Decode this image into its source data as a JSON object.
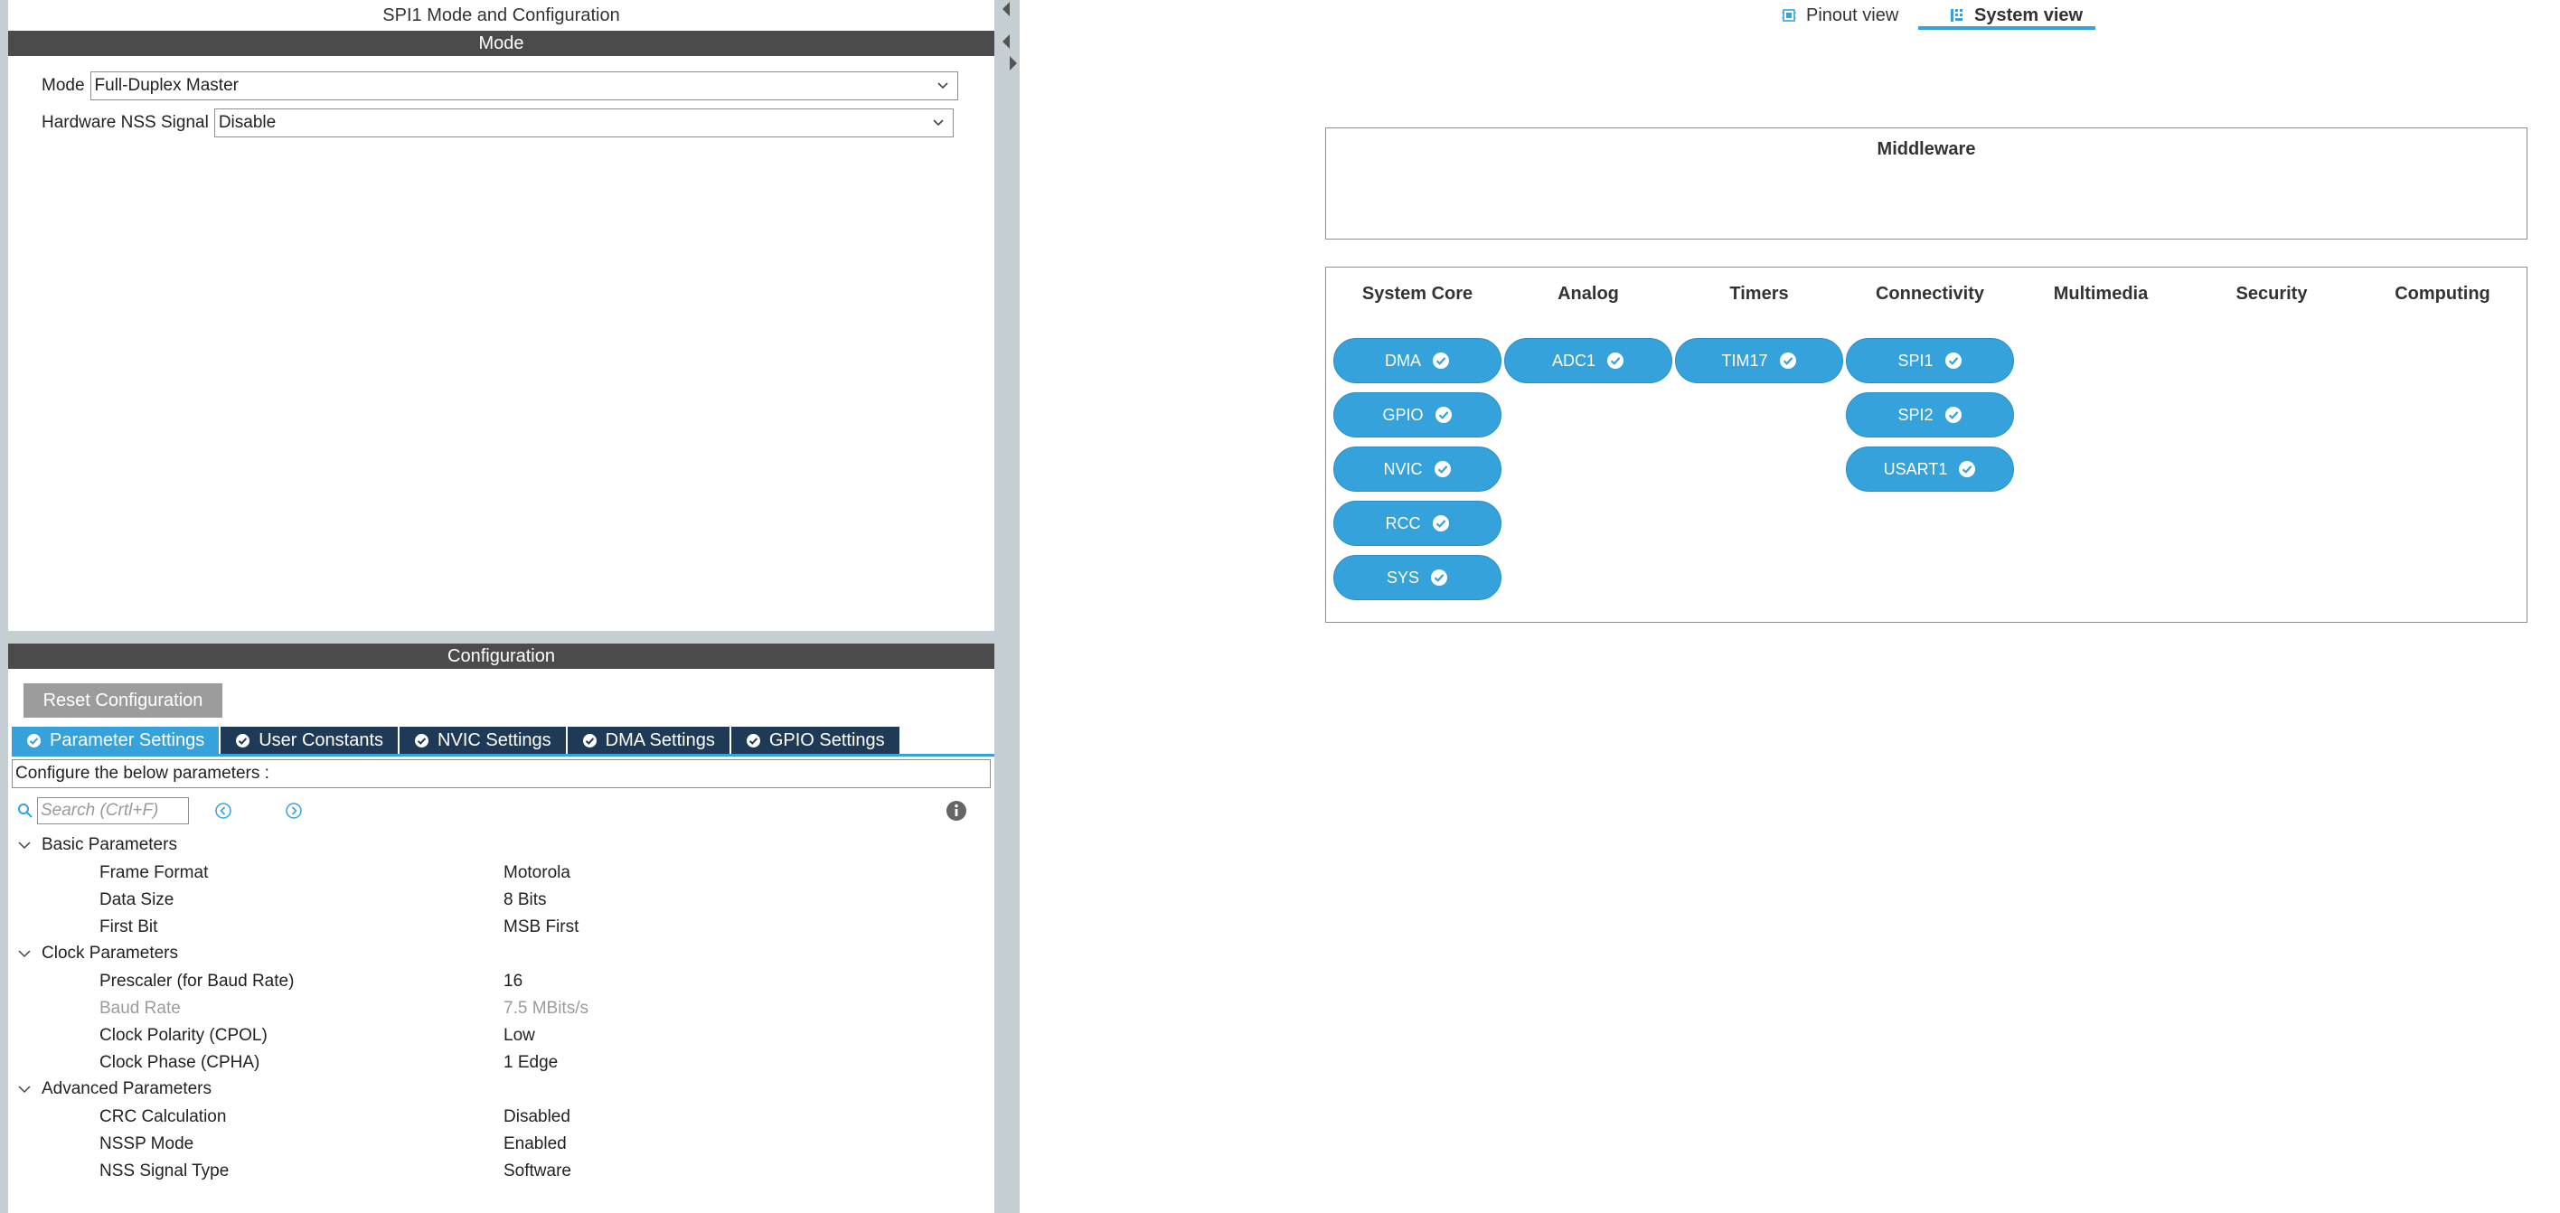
{
  "left": {
    "title": "SPI1 Mode and Configuration",
    "mode_section": "Mode",
    "mode_label": "Mode",
    "mode_value": "Full-Duplex Master",
    "nss_label": "Hardware NSS Signal",
    "nss_value": "Disable",
    "config_section": "Configuration",
    "reset_button": "Reset Configuration",
    "tabs": [
      {
        "label": "Parameter Settings",
        "active": true
      },
      {
        "label": "User Constants",
        "active": false
      },
      {
        "label": "NVIC Settings",
        "active": false
      },
      {
        "label": "DMA Settings",
        "active": false
      },
      {
        "label": "GPIO Settings",
        "active": false
      }
    ],
    "config_description": "Configure the below parameters :",
    "search_placeholder": "Search (Crtl+F)",
    "groups": [
      {
        "name": "Basic Parameters",
        "params": [
          {
            "name": "Frame Format",
            "value": "Motorola"
          },
          {
            "name": "Data Size",
            "value": "8 Bits"
          },
          {
            "name": "First Bit",
            "value": "MSB First"
          }
        ]
      },
      {
        "name": "Clock Parameters",
        "params": [
          {
            "name": "Prescaler (for Baud Rate)",
            "value": "16"
          },
          {
            "name": "Baud Rate",
            "value": "7.5 MBits/s",
            "disabled": true
          },
          {
            "name": "Clock Polarity (CPOL)",
            "value": "Low"
          },
          {
            "name": "Clock Phase (CPHA)",
            "value": "1 Edge"
          }
        ]
      },
      {
        "name": "Advanced Parameters",
        "params": [
          {
            "name": "CRC Calculation",
            "value": "Disabled"
          },
          {
            "name": "NSSP Mode",
            "value": "Enabled"
          },
          {
            "name": "NSS Signal Type",
            "value": "Software"
          }
        ]
      }
    ]
  },
  "right": {
    "view_tabs": [
      {
        "label": "Pinout view",
        "icon": "chip-icon",
        "active": false
      },
      {
        "label": "System view",
        "icon": "grid-icon",
        "active": true
      }
    ],
    "middleware_title": "Middleware",
    "categories": [
      {
        "name": "System Core",
        "items": [
          "DMA",
          "GPIO",
          "NVIC",
          "RCC",
          "SYS"
        ]
      },
      {
        "name": "Analog",
        "items": [
          "ADC1"
        ]
      },
      {
        "name": "Timers",
        "items": [
          "TIM17"
        ]
      },
      {
        "name": "Connectivity",
        "items": [
          "SPI1",
          "SPI2",
          "USART1"
        ]
      },
      {
        "name": "Multimedia",
        "items": []
      },
      {
        "name": "Security",
        "items": []
      },
      {
        "name": "Computing",
        "items": []
      }
    ]
  },
  "colors": {
    "accent": "#35a2dc",
    "tab_dark": "#1e3a57",
    "section_bar": "#4b4b4b",
    "panel_bg": "#c5ced3",
    "button_gray": "#9c9c9c"
  }
}
